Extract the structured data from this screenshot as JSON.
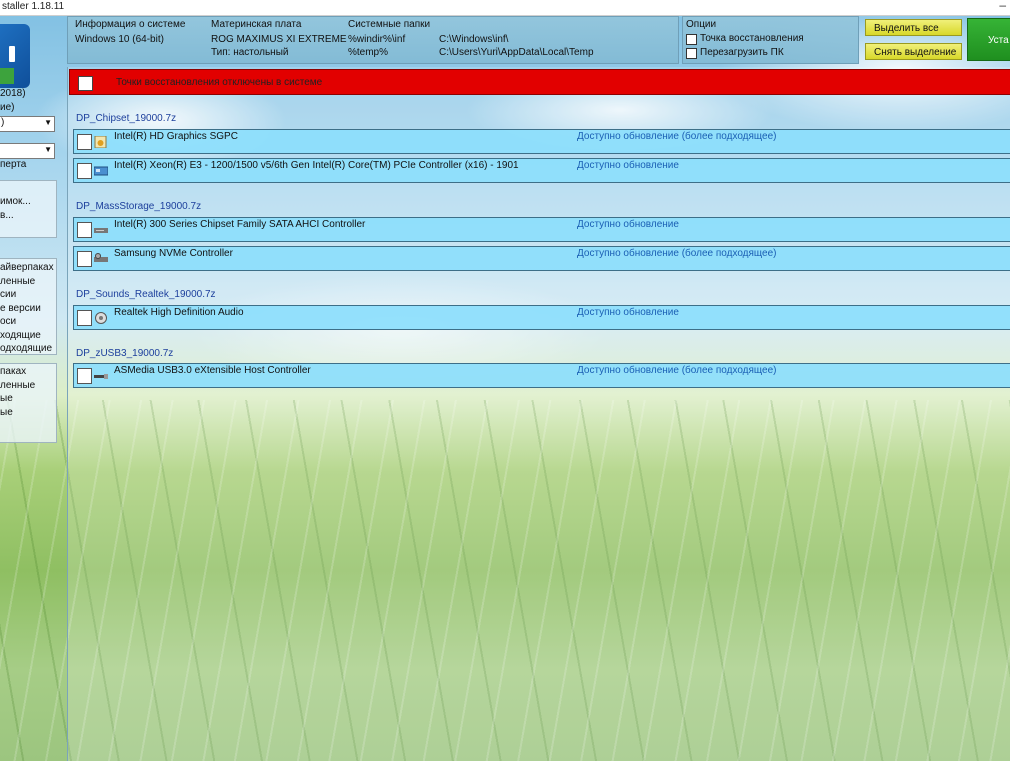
{
  "window": {
    "title": "staller 1.18.11",
    "minimize_glyph": "–"
  },
  "left": {
    "version": "2018)",
    "items_a": [
      "ие)"
    ],
    "select1": ")",
    "select2": "",
    "expert": "перта",
    "box1": [
      "имок...",
      "в..."
    ],
    "box2": [
      "айверпаках",
      "ленные",
      "сии",
      "е версии",
      "оси",
      "ходящие",
      "одходящие"
    ],
    "box3": [
      "пакаx",
      "ленные",
      "ые",
      "ые"
    ]
  },
  "sysinfo": {
    "col1_header": "Информация о системе",
    "col1_value": "Windows 10 (64-bit)",
    "col2_header": "Материнская плата",
    "col2_value1": "ROG MAXIMUS XI EXTREME",
    "col2_value2": "Тип: настольный",
    "col3_header": "Системные папки",
    "col3_key1": "%windir%\\inf",
    "col3_key2": "%temp%",
    "col3_val1": "C:\\Windows\\inf\\",
    "col3_val2": "C:\\Users\\Yuri\\AppData\\Local\\Temp"
  },
  "options": {
    "header": "Опции",
    "restore_point": "Точка восстановления",
    "reboot": "Перезагрузить ПК"
  },
  "buttons": {
    "select_all": "Выделить все",
    "deselect": "Снять выделение",
    "install": "Уста"
  },
  "warning": "Точки восстановления отключены в системе",
  "groups": [
    {
      "name": "DP_Chipset_19000.7z",
      "drivers": [
        {
          "name": "Intel(R) HD Graphics SGPC",
          "status": "Доступно обновление (более подходящее)",
          "icon": "display-adapter-icon"
        },
        {
          "name": "Intel(R) Xeon(R) E3 - 1200/1500 v5/6th Gen Intel(R) Core(TM) PCIe Controller (x16) - 1901",
          "status": "Доступно обновление",
          "icon": "pci-controller-icon"
        }
      ]
    },
    {
      "name": "DP_MassStorage_19000.7z",
      "drivers": [
        {
          "name": "Intel(R) 300 Series Chipset Family SATA AHCI Controller",
          "status": "Доступно обновление",
          "icon": "storage-controller-icon"
        },
        {
          "name": "Samsung NVMe Controller",
          "status": "Доступно обновление (более подходящее)",
          "icon": "storage-controller-icon"
        }
      ]
    },
    {
      "name": "DP_Sounds_Realtek_19000.7z",
      "drivers": [
        {
          "name": "Realtek High Definition Audio",
          "status": "Доступно обновление",
          "icon": "audio-icon"
        }
      ]
    },
    {
      "name": "DP_zUSB3_19000.7z",
      "drivers": [
        {
          "name": "ASMedia USB3.0 eXtensible Host Controller",
          "status": "Доступно обновление (более подходящее)",
          "icon": "usb-controller-icon"
        }
      ]
    }
  ]
}
